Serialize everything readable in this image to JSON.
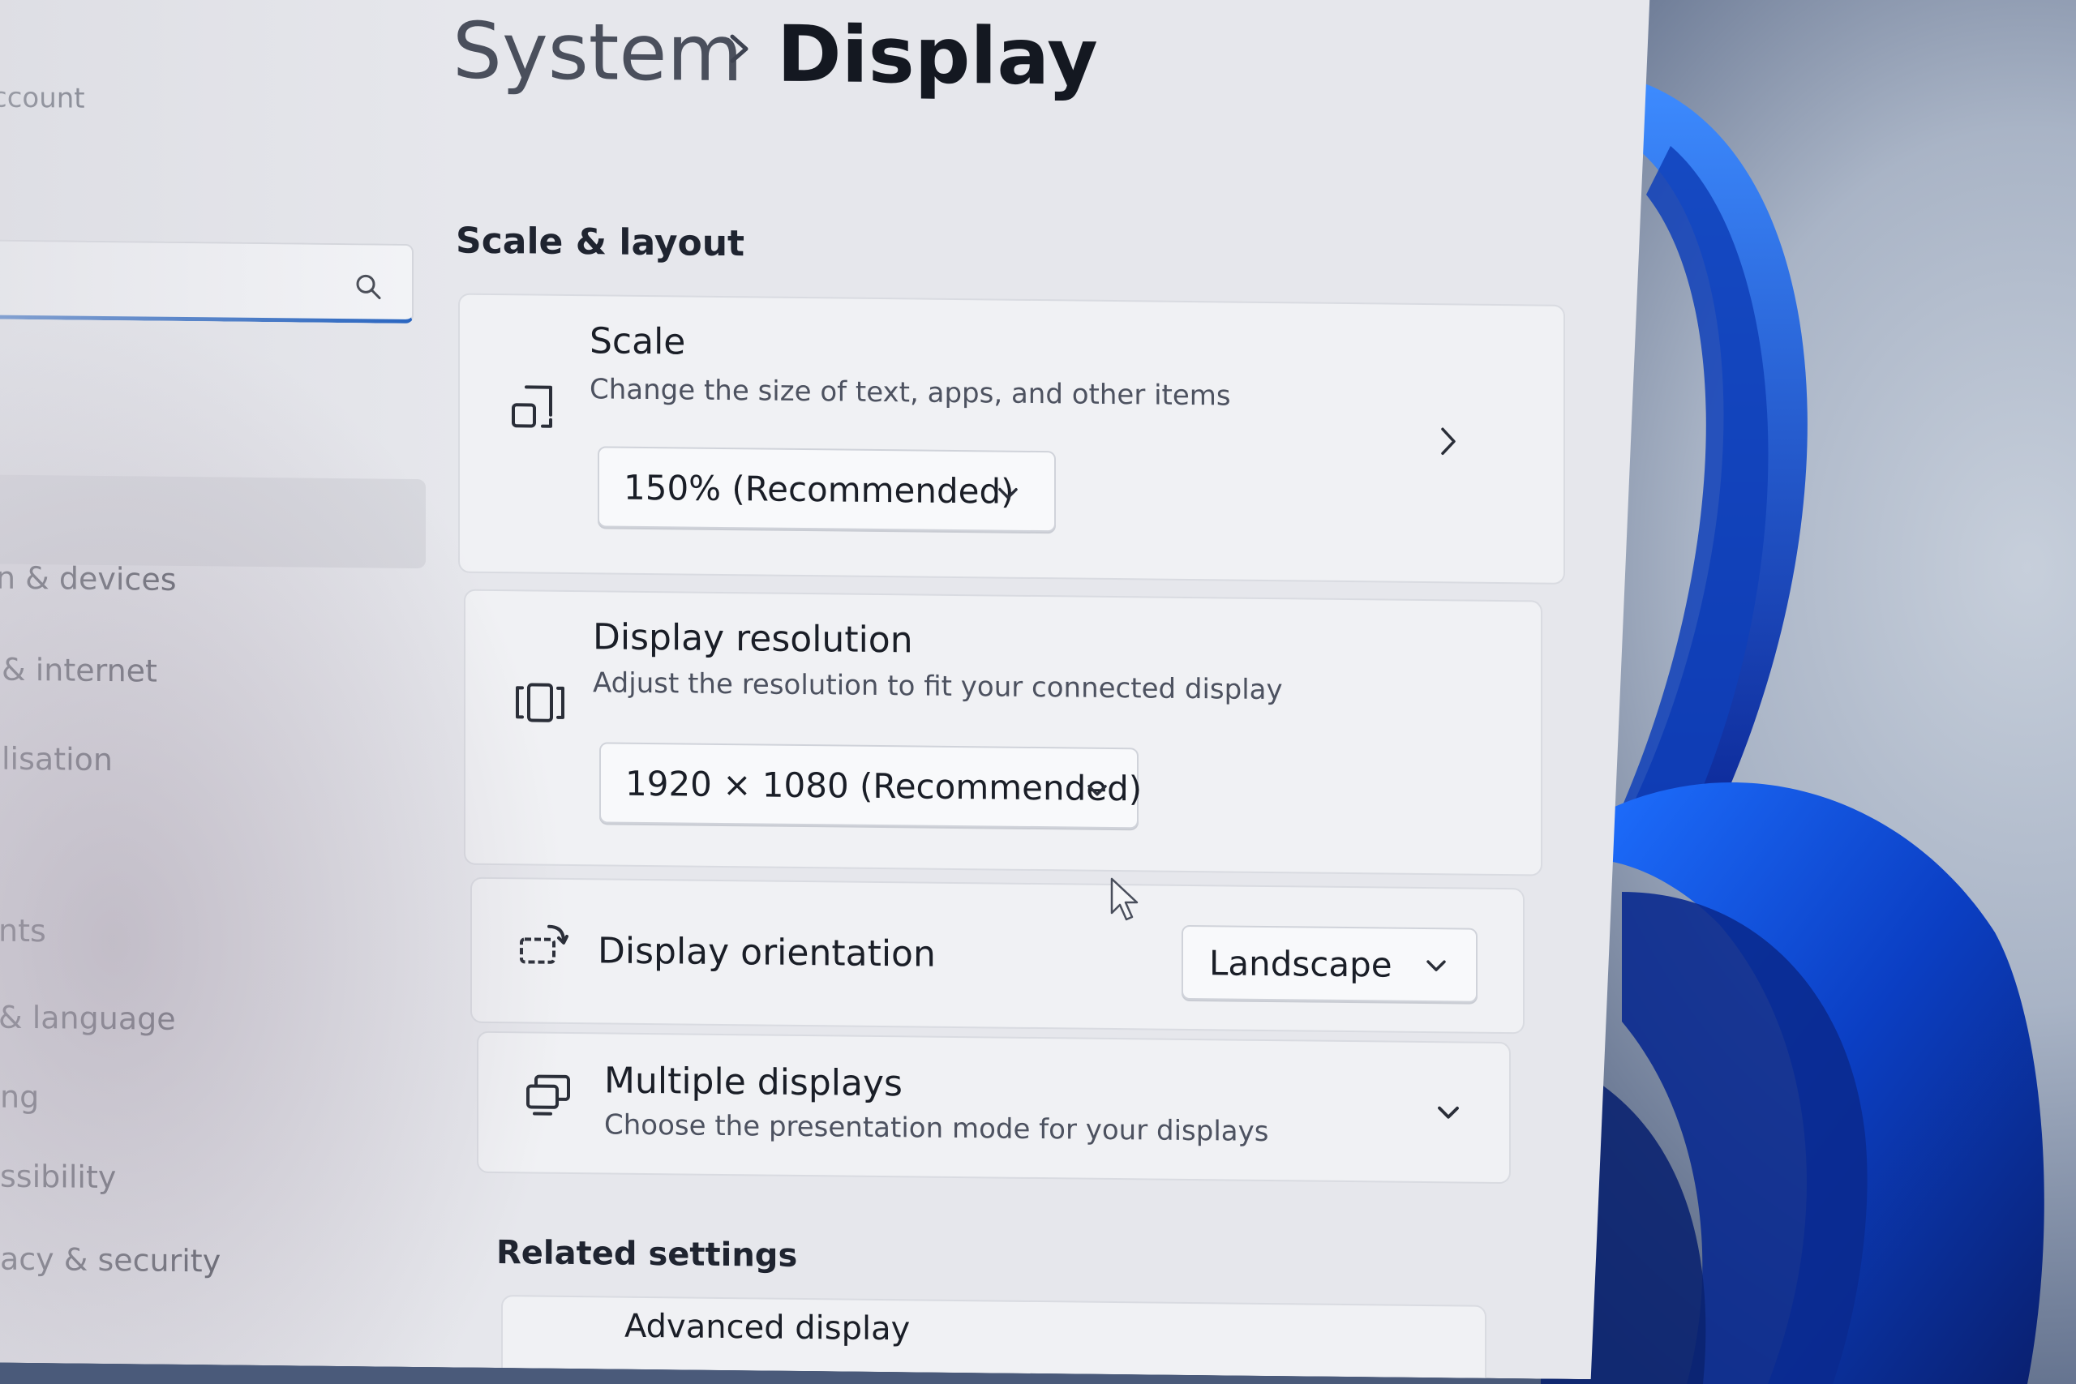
{
  "sidebar": {
    "account_fragment": "ccount",
    "search_placeholder": "",
    "items": [
      {
        "label": "n & devices"
      },
      {
        "label": "& internet"
      },
      {
        "label": "lisation"
      },
      {
        "label": "nts"
      },
      {
        "label": "& language"
      },
      {
        "label": "ng"
      },
      {
        "label": "ssibility"
      },
      {
        "label": "acy & security"
      }
    ]
  },
  "header": {
    "parent": "System",
    "current": "Display"
  },
  "sections": {
    "scale_layout": "Scale & layout",
    "related": "Related settings"
  },
  "cards": {
    "scale": {
      "title": "Scale",
      "subtitle": "Change the size of text, apps, and other items",
      "value": "150% (Recommended)"
    },
    "resolution": {
      "title": "Display resolution",
      "subtitle": "Adjust the resolution to fit your connected display",
      "value": "1920 × 1080 (Recommended)"
    },
    "orientation": {
      "title": "Display orientation",
      "value": "Landscape"
    },
    "multiple": {
      "title": "Multiple displays",
      "subtitle": "Choose the presentation mode for your displays"
    },
    "advanced": {
      "title": "Advanced display"
    }
  },
  "icons": {
    "search": "search-icon",
    "scale": "scale-icon",
    "resolution": "resolution-icon",
    "orientation": "orientation-icon",
    "multiple": "multiple-displays-icon"
  },
  "colors": {
    "accent": "#1f5fbf",
    "window_bg": "#e6e7ec",
    "card_bg": "#f0f1f4"
  }
}
